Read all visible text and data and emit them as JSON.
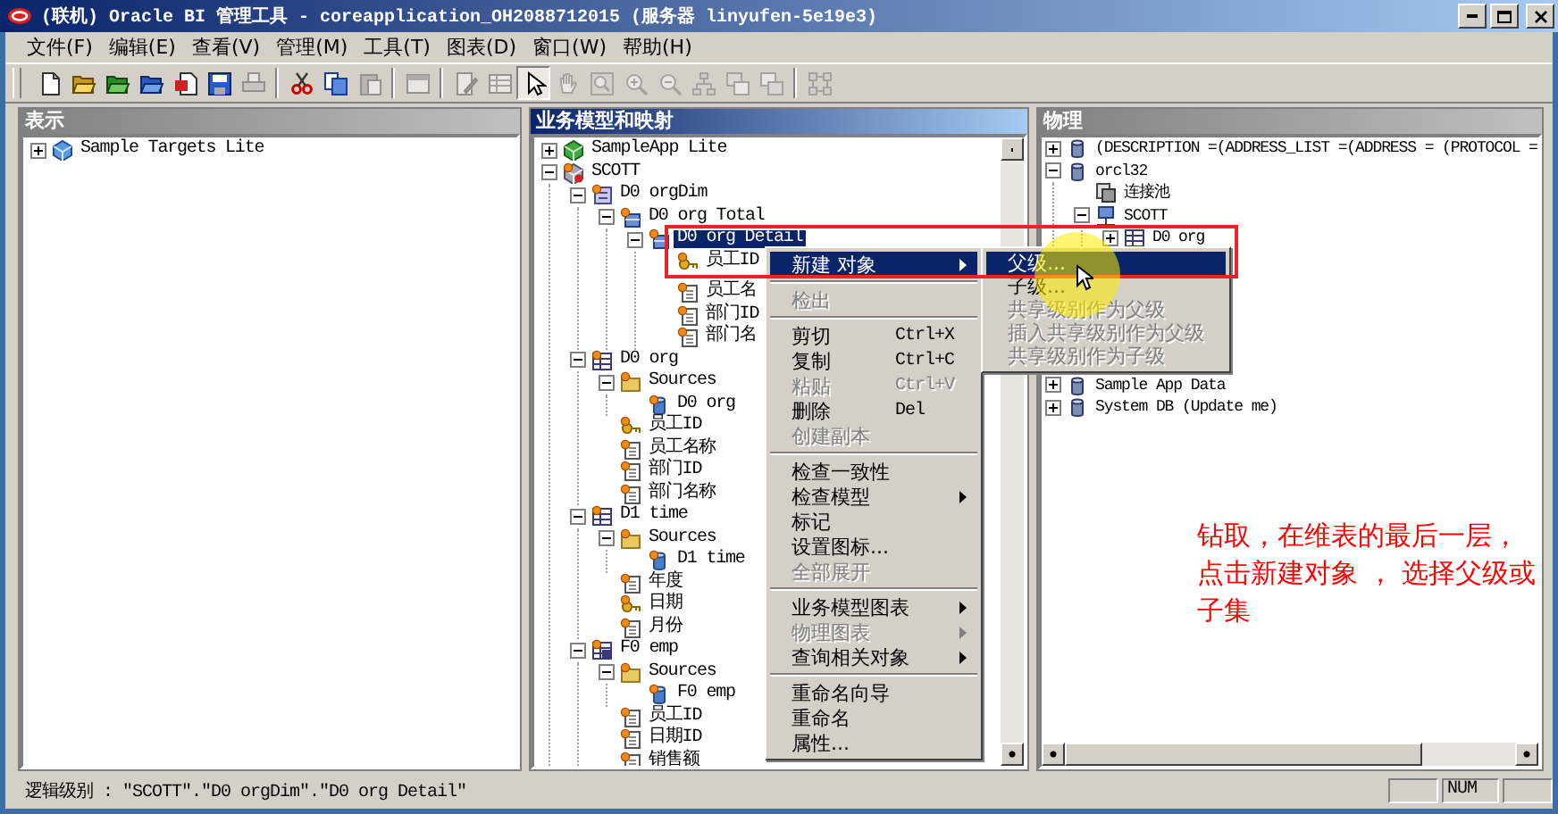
{
  "window": {
    "title": "(联机) Oracle BI 管理工具 - coreapplication_OH2088712015 (服务器 linyufen-5e19e3)"
  },
  "menu_bar": [
    "文件(F)",
    "编辑(E)",
    "查看(V)",
    "管理(M)",
    "工具(T)",
    "图表(D)",
    "窗口(W)",
    "帮助(H)"
  ],
  "toolbar": [
    {
      "kind": "new",
      "disabled": false,
      "selected": false
    },
    {
      "kind": "open",
      "disabled": false,
      "selected": false
    },
    {
      "kind": "open-online",
      "disabled": false,
      "selected": false
    },
    {
      "kind": "open-repository",
      "disabled": false,
      "selected": false
    },
    {
      "kind": "import",
      "disabled": false,
      "selected": false
    },
    {
      "kind": "save",
      "disabled": false,
      "selected": false
    },
    {
      "kind": "print",
      "disabled": true,
      "selected": false
    },
    {
      "kind": "separator"
    },
    {
      "kind": "cut",
      "disabled": false,
      "selected": false
    },
    {
      "kind": "copy",
      "disabled": false,
      "selected": false
    },
    {
      "kind": "paste",
      "disabled": true,
      "selected": false
    },
    {
      "kind": "separator"
    },
    {
      "kind": "query",
      "disabled": true,
      "selected": false
    },
    {
      "kind": "separator"
    },
    {
      "kind": "edit",
      "disabled": true,
      "selected": false
    },
    {
      "kind": "properties",
      "disabled": true,
      "selected": false
    },
    {
      "kind": "pointer",
      "disabled": false,
      "selected": true
    },
    {
      "kind": "hand",
      "disabled": true,
      "selected": false
    },
    {
      "kind": "zoom-fit",
      "disabled": true,
      "selected": false
    },
    {
      "kind": "zoom-in",
      "disabled": true,
      "selected": false
    },
    {
      "kind": "zoom-out",
      "disabled": true,
      "selected": false
    },
    {
      "kind": "tree-layout",
      "disabled": true,
      "selected": false
    },
    {
      "kind": "collapse",
      "disabled": true,
      "selected": false
    },
    {
      "kind": "expand",
      "disabled": true,
      "selected": false
    },
    {
      "kind": "separator"
    },
    {
      "kind": "grid-layout",
      "disabled": true,
      "selected": false
    }
  ],
  "presentation": {
    "title": "表示",
    "active": false,
    "tree": [
      {
        "label": "Sample Targets Lite",
        "kind": "subject-area",
        "expanded": false,
        "selected": false
      }
    ]
  },
  "business_model": {
    "title": "业务模型和映射",
    "active": true,
    "tree": [
      {
        "label": "SampleApp Lite",
        "kind": "business-model",
        "expanded": false,
        "selected": false
      },
      {
        "label": "SCOTT",
        "kind": "business-model-warning",
        "expanded": true,
        "selected": false,
        "children": [
          {
            "label": "D0 orgDim",
            "kind": "dimension",
            "expanded": true,
            "selected": false,
            "children": [
              {
                "label": "D0 org Total",
                "kind": "level",
                "expanded": true,
                "selected": false,
                "children": [
                  {
                    "label": "D0 org Detail",
                    "kind": "level",
                    "expanded": true,
                    "selected": true,
                    "children": [
                      {
                        "label": "员工ID",
                        "kind": "key-column",
                        "selected": false
                      },
                      {
                        "label": "员工名",
                        "kind": "column",
                        "selected": false
                      },
                      {
                        "label": "部门ID",
                        "kind": "column",
                        "selected": false
                      },
                      {
                        "label": "部门名",
                        "kind": "column",
                        "selected": false
                      }
                    ]
                  }
                ]
              }
            ]
          },
          {
            "label": "D0 org",
            "kind": "logical-table",
            "expanded": true,
            "selected": false,
            "children": [
              {
                "label": "Sources",
                "kind": "folder",
                "expanded": true,
                "selected": false,
                "children": [
                  {
                    "label": "D0 org",
                    "kind": "table-source",
                    "selected": false
                  }
                ]
              },
              {
                "label": "员工ID",
                "kind": "key-column",
                "selected": false
              },
              {
                "label": "员工名称",
                "kind": "column",
                "selected": false
              },
              {
                "label": "部门ID",
                "kind": "column",
                "selected": false
              },
              {
                "label": "部门名称",
                "kind": "column",
                "selected": false
              }
            ]
          },
          {
            "label": "D1 time",
            "kind": "logical-table",
            "expanded": true,
            "selected": false,
            "children": [
              {
                "label": "Sources",
                "kind": "folder",
                "expanded": true,
                "selected": false,
                "children": [
                  {
                    "label": "D1 time",
                    "kind": "table-source",
                    "selected": false
                  }
                ]
              },
              {
                "label": "年度",
                "kind": "column",
                "selected": false
              },
              {
                "label": "日期",
                "kind": "key-column",
                "selected": false
              },
              {
                "label": "月份",
                "kind": "column",
                "selected": false
              }
            ]
          },
          {
            "label": "F0 emp",
            "kind": "fact-table",
            "expanded": true,
            "selected": false,
            "children": [
              {
                "label": "Sources",
                "kind": "folder",
                "expanded": true,
                "selected": false,
                "children": [
                  {
                    "label": "F0 emp",
                    "kind": "table-source",
                    "selected": false
                  }
                ]
              },
              {
                "label": "员工ID",
                "kind": "column",
                "selected": false
              },
              {
                "label": "日期ID",
                "kind": "column",
                "selected": false
              },
              {
                "label": "销售额",
                "kind": "column",
                "selected": false
              }
            ]
          }
        ]
      }
    ]
  },
  "physical": {
    "title": "物理",
    "active": false,
    "tree": [
      {
        "label": "(DESCRIPTION =(ADDRESS_LIST =(ADDRESS = (PROTOCOL =",
        "kind": "database",
        "expanded": false,
        "selected": false
      },
      {
        "label": "orcl32",
        "kind": "database",
        "expanded": true,
        "selected": false,
        "children": [
          {
            "label": "连接池",
            "kind": "connection-pool",
            "selected": false
          },
          {
            "label": "SCOTT",
            "kind": "schema",
            "expanded": true,
            "selected": false,
            "children": [
              {
                "label": "D0 org",
                "kind": "physical-table",
                "expanded": false,
                "selected": false
              }
            ]
          }
        ]
      },
      {
        "label": "Sample App Data",
        "kind": "database",
        "expanded": false,
        "selected": false
      },
      {
        "label": "System DB (Update me)",
        "kind": "database",
        "expanded": false,
        "selected": false
      }
    ]
  },
  "context_menu": {
    "groups": [
      [
        {
          "label": "新建 对象",
          "submenu": true,
          "disabled": false,
          "selected": true
        }
      ],
      [
        {
          "label": "检出",
          "disabled": true,
          "selected": false
        }
      ],
      [
        {
          "label": "剪切",
          "shortcut": "Ctrl+X",
          "disabled": false,
          "selected": false
        },
        {
          "label": "复制",
          "shortcut": "Ctrl+C",
          "disabled": false,
          "selected": false
        },
        {
          "label": "粘贴",
          "shortcut": "Ctrl+V",
          "disabled": true,
          "selected": false
        },
        {
          "label": "删除",
          "shortcut": "Del",
          "disabled": false,
          "selected": false
        },
        {
          "label": "创建副本",
          "disabled": true,
          "selected": false
        }
      ],
      [
        {
          "label": "检查一致性",
          "disabled": false,
          "selected": false
        },
        {
          "label": "检查模型",
          "submenu": true,
          "disabled": false,
          "selected": false
        },
        {
          "label": "标记",
          "disabled": false,
          "selected": false
        },
        {
          "label": "设置图标...",
          "disabled": false,
          "selected": false
        },
        {
          "label": "全部展开",
          "disabled": true,
          "selected": false
        }
      ],
      [
        {
          "label": "业务模型图表",
          "submenu": true,
          "disabled": false,
          "selected": false
        },
        {
          "label": "物理图表",
          "submenu": true,
          "disabled": true,
          "selected": false
        },
        {
          "label": "查询相关对象",
          "submenu": true,
          "disabled": false,
          "selected": false
        }
      ],
      [
        {
          "label": "重命名向导",
          "disabled": false,
          "selected": false
        },
        {
          "label": "重命名",
          "disabled": false,
          "selected": false
        },
        {
          "label": "属性...",
          "disabled": false,
          "selected": false
        }
      ]
    ]
  },
  "submenu": {
    "items": [
      {
        "label": "父级...",
        "disabled": false,
        "selected": true
      },
      {
        "label": "子级...",
        "disabled": false,
        "selected": false
      },
      {
        "label": "共享级别作为父级",
        "disabled": true,
        "selected": false
      },
      {
        "label": "插入共享级别作为父级",
        "disabled": true,
        "selected": false
      },
      {
        "label": "共享级别作为子级",
        "disabled": true,
        "selected": false
      }
    ]
  },
  "annotation": {
    "lines": [
      "钻取，在维表的最后一层，",
      "点击新建对象 ， 选择父级或",
      "子集"
    ]
  },
  "status_bar": {
    "text": "逻辑级别 : \"SCOTT\".\"D0 orgDim\".\"D0 org Detail\"",
    "indicators": [
      "NUM"
    ]
  }
}
